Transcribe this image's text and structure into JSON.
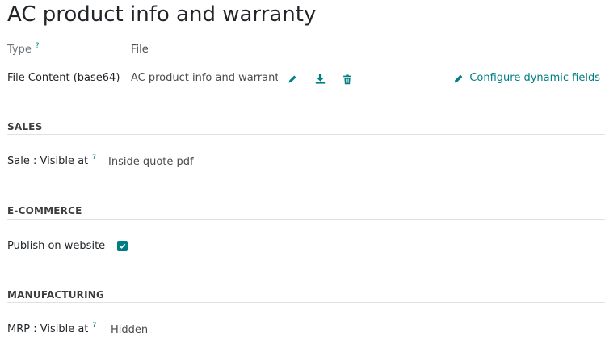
{
  "record": {
    "title": "AC product info and warranty"
  },
  "fields": {
    "type": {
      "label": "Type",
      "help": "?",
      "value": "File"
    },
    "file_content": {
      "label": "File Content (base64)",
      "value": "AC product info and warranty"
    },
    "configure_label": "Configure dynamic fields"
  },
  "sections": {
    "sales": {
      "title": "SALES",
      "field": {
        "label": "Sale : Visible at",
        "help": "?",
        "value": "Inside quote pdf"
      }
    },
    "ecommerce": {
      "title": "E-COMMERCE",
      "field": {
        "label": "Publish on website",
        "checked": true
      }
    },
    "manufacturing": {
      "title": "MANUFACTURING",
      "field": {
        "label": "MRP : Visible at",
        "help": "?",
        "value": "Hidden"
      }
    }
  },
  "colors": {
    "accent": "#017e84",
    "rule": "#dee2e6"
  },
  "icons": {
    "edit": "pencil-icon",
    "download": "download-icon",
    "delete": "trash-icon",
    "configure": "pencil-icon",
    "checkbox": "checkmark-icon"
  }
}
